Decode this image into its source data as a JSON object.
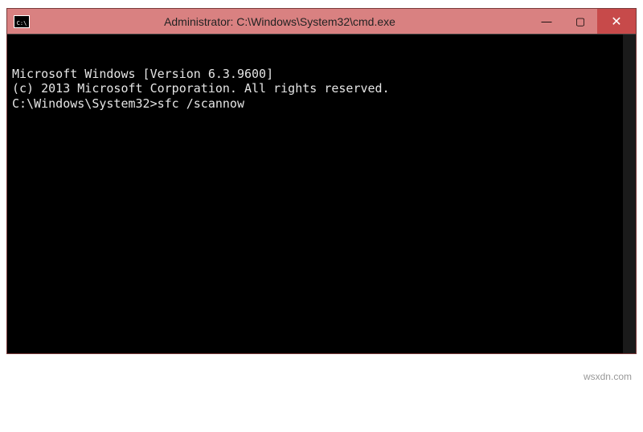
{
  "titlebar": {
    "icon_label": "C:\\",
    "title": "Administrator: C:\\Windows\\System32\\cmd.exe",
    "minimize": "—",
    "maximize": "▢",
    "close": "✕"
  },
  "terminal": {
    "line1": "Microsoft Windows [Version 6.3.9600]",
    "line2": "(c) 2013 Microsoft Corporation. All rights reserved.",
    "blank1": "",
    "prompt": "C:\\Windows\\System32>",
    "command": "sfc /scannow"
  },
  "watermark": "wsxdn.com"
}
